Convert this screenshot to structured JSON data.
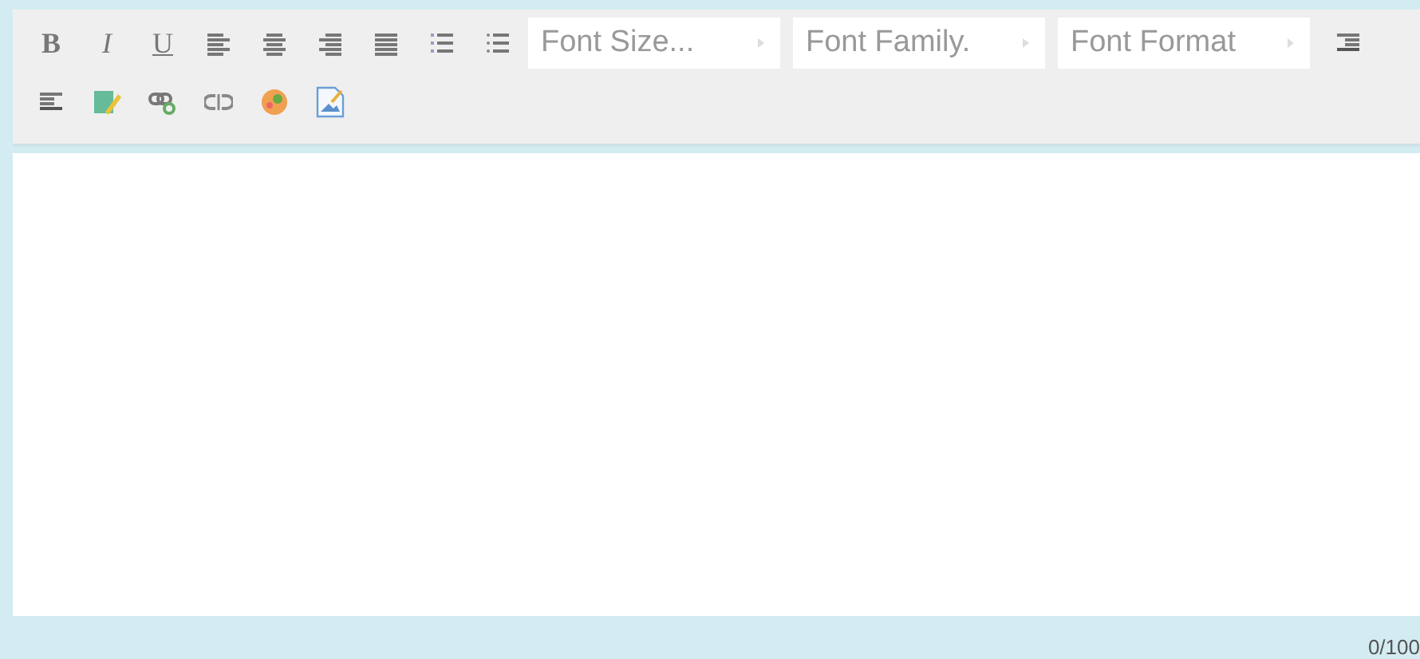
{
  "toolbar": [
    {
      "kind": "bold",
      "label": "B"
    },
    {
      "kind": "italic",
      "label": "I"
    },
    {
      "kind": "underline",
      "label": "U"
    },
    {
      "kind": "align-left"
    },
    {
      "kind": "align-center"
    },
    {
      "kind": "align-right"
    },
    {
      "kind": "align-justify"
    },
    {
      "kind": "ordered-list"
    },
    {
      "kind": "unordered-list"
    },
    {
      "kind": "select",
      "placeholder": "Font Size..."
    },
    {
      "kind": "select",
      "placeholder": "Font Family."
    },
    {
      "kind": "select",
      "placeholder": "Font Format"
    },
    {
      "kind": "indent"
    },
    {
      "kind": "outdent"
    },
    {
      "kind": "spellcheck"
    },
    {
      "kind": "link"
    },
    {
      "kind": "unlink"
    },
    {
      "kind": "color"
    },
    {
      "kind": "image"
    }
  ],
  "editor": {
    "counter": "0/100"
  }
}
